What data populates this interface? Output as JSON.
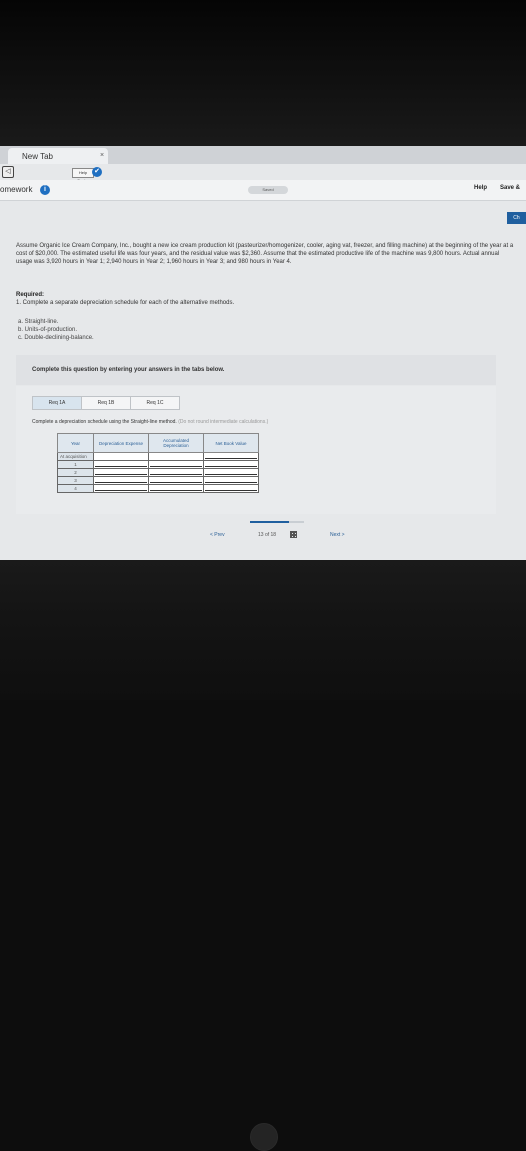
{
  "browser": {
    "tab_title": "New Tab",
    "tab_close": "×",
    "back_label": "◁",
    "help_center_label": "Help Center",
    "help_center_icon": "✔"
  },
  "header": {
    "title": "omework",
    "info_icon": "i",
    "status": "Saved",
    "help_label": "Help",
    "save_label": "Save &",
    "check_label": "Ch"
  },
  "problem": {
    "text": "Assume Organic Ice Cream Company, Inc., bought a new ice cream production kit (pasteurizer/homogenizer, cooler, aging vat, freezer, and filling machine) at the beginning of the year at a cost of $20,000. The estimated useful life was four years, and the residual value was $2,360. Assume that the estimated productive life of the machine was 9,800 hours. Actual annual usage was 3,920 hours in Year 1; 2,940 hours in Year 2; 1,960 hours in Year 3; and 980 hours in Year 4.",
    "required_heading": "Required:",
    "required_text": "1. Complete a separate depreciation schedule for each of the alternative methods.",
    "methods": [
      "a. Straight-line.",
      "b. Units-of-production.",
      "c. Double-declining-balance."
    ]
  },
  "instruction": "Complete this question by entering your answers in the tabs below.",
  "tabs": [
    {
      "label": "Req 1A"
    },
    {
      "label": "Req 1B"
    },
    {
      "label": "Req 1C"
    }
  ],
  "tab_content": {
    "text": "Complete a depreciation schedule using the Straight-line method.",
    "note": "(Do not round intermediate calculations.)"
  },
  "table": {
    "headers": [
      "Year",
      "Depreciation Expense",
      "Accumulated Depreciation",
      "Net Book Value"
    ],
    "rows": [
      "At acquisition",
      "1",
      "2",
      "3",
      "4"
    ]
  },
  "pager": {
    "prev_label": "< Prev",
    "page_text": "13 of 18",
    "next_label": "Next >"
  },
  "progress": 0.72
}
